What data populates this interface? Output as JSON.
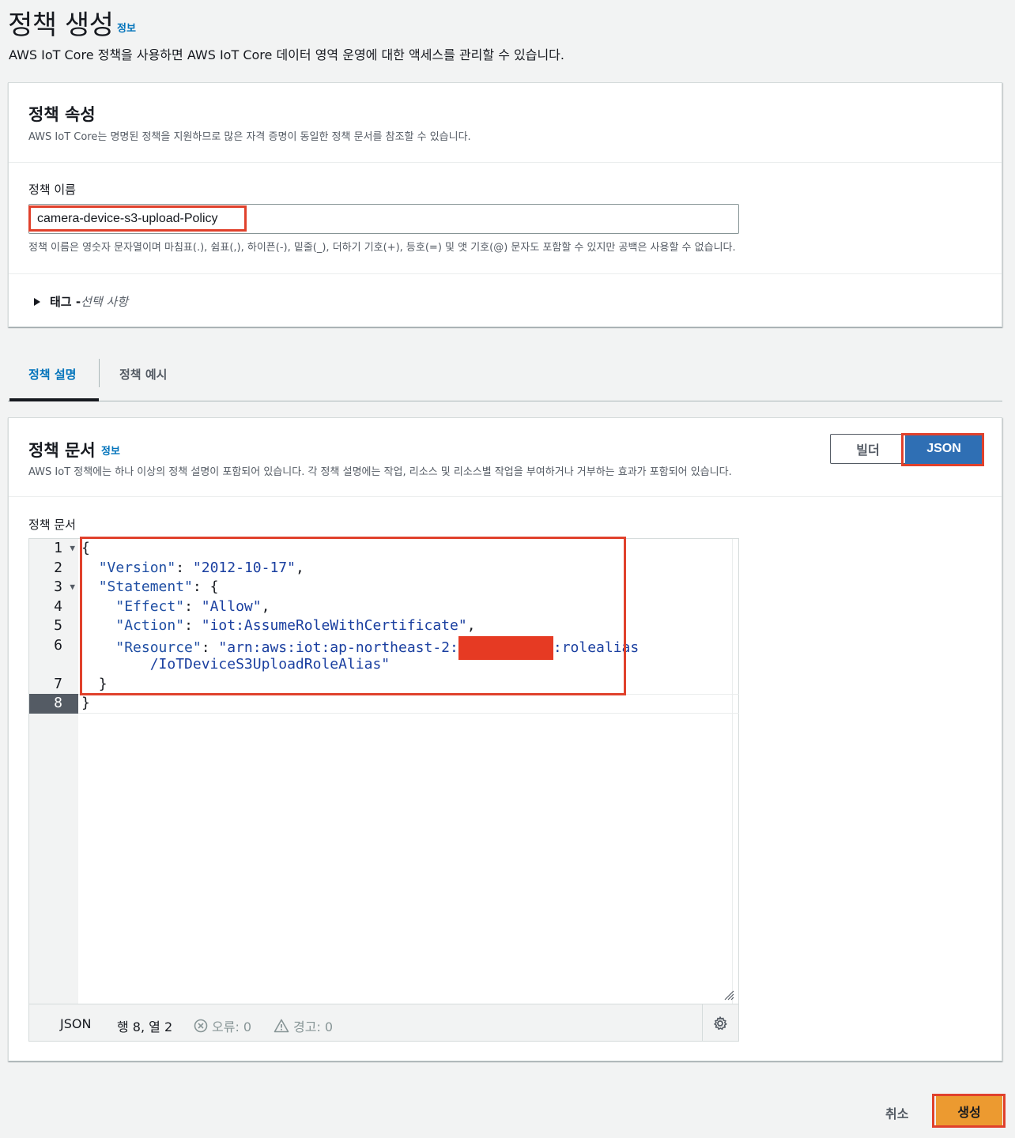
{
  "header": {
    "title": "정책 생성",
    "info": "정보",
    "description": "AWS IoT Core 정책을 사용하면 AWS IoT Core 데이터 영역 운영에 대한 액세스를 관리할 수 있습니다."
  },
  "properties": {
    "title": "정책 속성",
    "description": "AWS IoT Core는 명명된 정책을 지원하므로 많은 자격 증명이 동일한 정책 문서를 참조할 수 있습니다.",
    "name_label": "정책 이름",
    "name_value": "camera-device-s3-upload-Policy",
    "name_hint": "정책 이름은 영숫자 문자열이며 마침표(.), 쉼표(,), 하이픈(-), 밑줄(_), 더하기 기호(+), 등호(=) 및 앳 기호(@) 문자도 포함할 수 있지만 공백은 사용할 수 없습니다.",
    "tags_prefix": "태그 - ",
    "tags_optional": "선택 사항"
  },
  "tabs": [
    {
      "label": "정책 설명",
      "active": true
    },
    {
      "label": "정책 예시",
      "active": false
    }
  ],
  "document": {
    "title": "정책 문서",
    "info": "정보",
    "description": "AWS IoT 정책에는 하나 이상의 정책 설명이 포함되어 있습니다. 각 정책 설명에는 작업, 리소스 및 리소스별 작업을 부여하거나 거부하는 효과가 포함되어 있습니다.",
    "mode_builder": "빌더",
    "mode_json": "JSON",
    "editor_label": "정책 문서",
    "code": {
      "open": "{",
      "version_key": "\"Version\"",
      "version_val": "\"2012-10-17\"",
      "statement_key": "\"Statement\"",
      "effect_key": "\"Effect\"",
      "effect_val": "\"Allow\"",
      "action_key": "\"Action\"",
      "action_val": "\"iot:AssumeRoleWithCertificate\"",
      "resource_key": "\"Resource\"",
      "resource_val_a": "\"arn:aws:iot:ap-northeast-2:",
      "resource_val_b": ":rolealias",
      "resource_val_c": "/IoTDeviceS3UploadRoleAlias\"",
      "close_inner": "}",
      "close": "}"
    },
    "gutter": [
      "1",
      "2",
      "3",
      "4",
      "5",
      "6",
      "7",
      "8"
    ],
    "status": {
      "language": "JSON",
      "position": "행 8, 열 2",
      "errors": "오류: 0",
      "warnings": "경고: 0"
    }
  },
  "footer": {
    "cancel": "취소",
    "create": "생성"
  },
  "colors": {
    "accent_blue": "#0073bb",
    "json_button": "#2f6fb4",
    "create_button": "#ec9a30",
    "highlight_border": "#e0412c"
  }
}
